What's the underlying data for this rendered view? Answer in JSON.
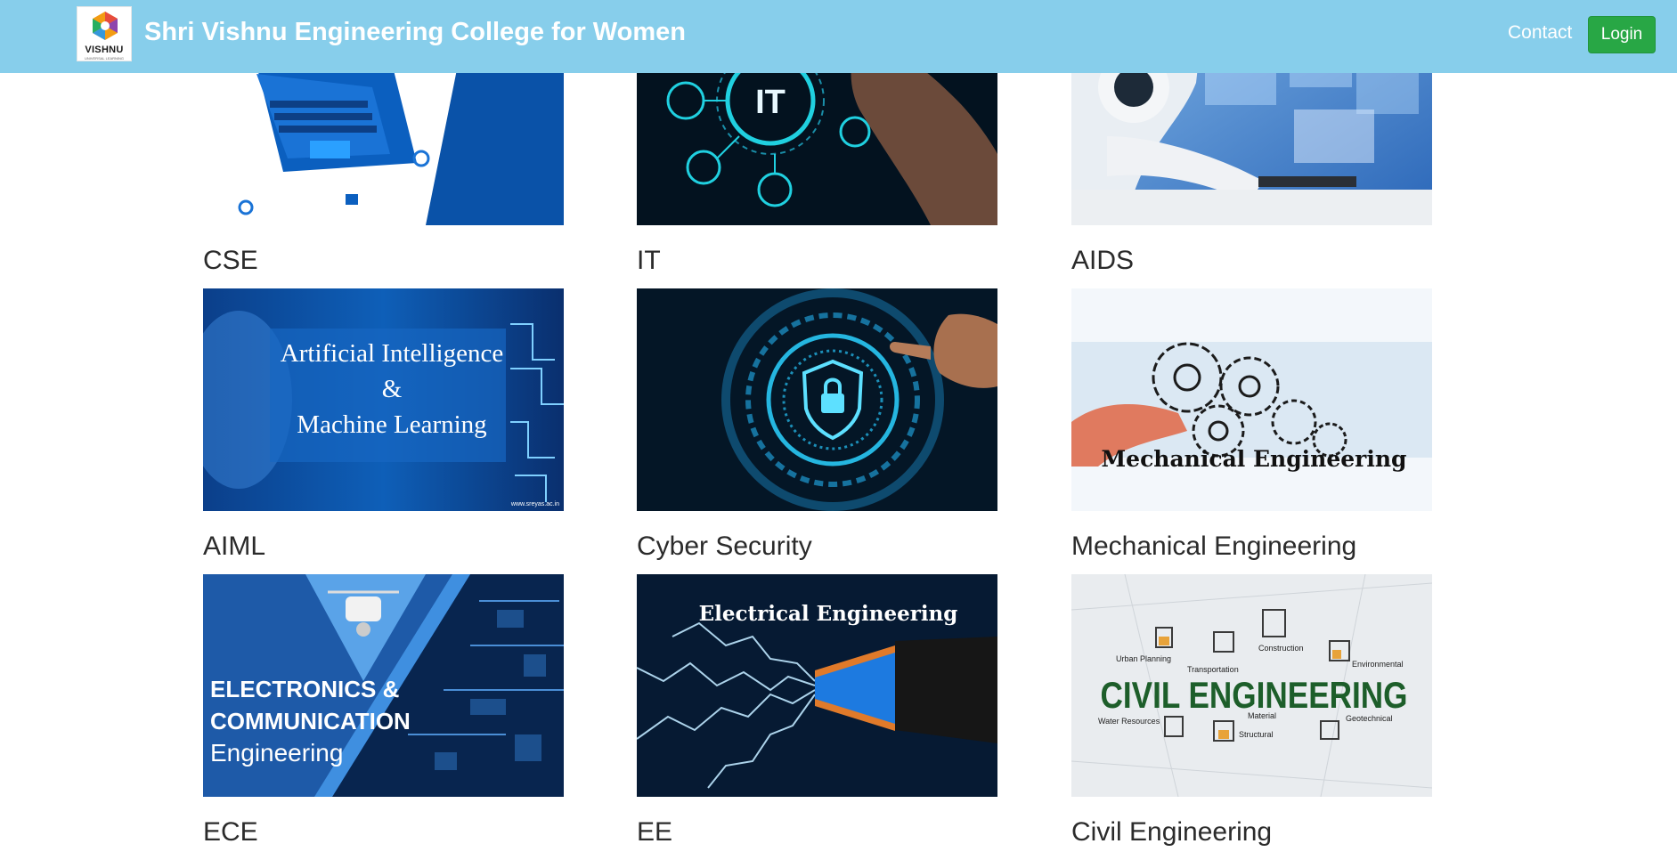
{
  "header": {
    "logo_text": "VISHNU",
    "logo_subtext": "UNIVERSAL LEARNING",
    "brand_title": "Shri Vishnu Engineering College for Women",
    "contact_label": "Contact",
    "login_label": "Login"
  },
  "courses": [
    {
      "name": "CSE",
      "image_icon": "laptop-illustration-icon"
    },
    {
      "name": "IT",
      "image_text": "IT",
      "image_icon": "it-network-touch-icon"
    },
    {
      "name": "AIDS",
      "image_icon": "robot-laptop-icon"
    },
    {
      "name": "AIML",
      "image_line1": "Artificial Intelligence",
      "image_line2": "&",
      "image_line3": "Machine Learning",
      "image_credit": "www.sreyas.ac.in"
    },
    {
      "name": "Cyber Security",
      "image_icon": "shield-lock-icon"
    },
    {
      "name": "Mechanical Engineering",
      "image_text": "Mechanical Engineering",
      "image_icon": "gears-icon"
    },
    {
      "name": "ECE",
      "image_line1": "ELECTRONICS &",
      "image_line2": "COMMUNICATION",
      "image_line3": "Engineering",
      "image_icon": "drone-circuit-icon"
    },
    {
      "name": "EE",
      "image_text": "Electrical Engineering",
      "image_icon": "cable-lightning-icon"
    },
    {
      "name": "Civil Engineering",
      "image_text": "CIVIL ENGINEERING",
      "image_labels": [
        "Urban Planning",
        "Transportation",
        "Construction",
        "Environmental",
        "Water Resources",
        "Material",
        "Structural",
        "Geotechnical"
      ]
    }
  ],
  "colors": {
    "navbar_bg": "#87ceeb",
    "login_bg": "#28a745",
    "card_blue": "#0d4fa8",
    "civil_green": "#1d5e2a"
  }
}
